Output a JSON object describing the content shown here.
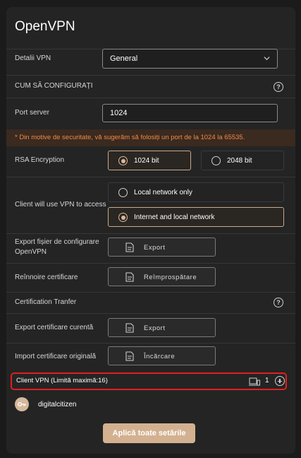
{
  "title": "OpenVPN",
  "vpn_details": {
    "label": "Detalii VPN",
    "selected": "General"
  },
  "how_to": {
    "label": "CUM SĂ CONFIGURAȚI"
  },
  "port": {
    "label": "Port server",
    "value": "1024"
  },
  "warning": "* Din motive de securitate, vă sugerăm să folosiți un port de la 1024 la 65535.",
  "rsa": {
    "label": "RSA Encryption",
    "options": [
      "1024 bit",
      "2048 bit"
    ],
    "selected": "1024 bit"
  },
  "access": {
    "label": "Client will use VPN to access",
    "options": [
      "Local network only",
      "Internet and local network"
    ],
    "selected": "Internet and local network"
  },
  "export_config": {
    "label": "Export fișier de configurare OpenVPN",
    "button": "Export"
  },
  "renew_cert": {
    "label": "Reînnoire certificare",
    "button": "Reîmprospătare"
  },
  "cert_transfer": {
    "label": "Certification Tranfer"
  },
  "export_cert": {
    "label": "Export certificare curentă",
    "button": "Export"
  },
  "import_cert": {
    "label": "Import certificare originală",
    "button": "Încărcare"
  },
  "client_vpn": {
    "label": "Client VPN (Limită maximă:16)",
    "count": "1"
  },
  "user": {
    "name": "digitalcitizen"
  },
  "apply_button": "Aplică toate setările",
  "colors": {
    "accent": "#d3b190",
    "warning_text": "#f0894a",
    "highlight": "#e0201f"
  },
  "icons": [
    "chevron-down-icon",
    "help-icon",
    "document-icon",
    "devices-icon",
    "plus-icon",
    "key-icon"
  ]
}
